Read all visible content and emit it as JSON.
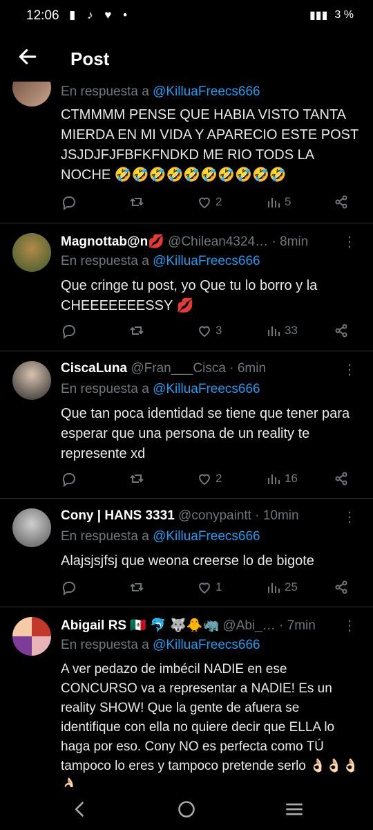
{
  "status": {
    "time": "12:06",
    "left_icons": "▮ ♪ ♥ •",
    "signal": "▮▮▮",
    "battery": "3 %"
  },
  "header": {
    "title": "Post"
  },
  "reply_prefix": "En respuesta a",
  "tweets": [
    {
      "name": "",
      "handle": "",
      "time": "",
      "reply_to": "@KilluaFreecs666",
      "body": "CTMMMM PENSE QUE HABIA VISTO TANTA MIERDA  EN MI VIDA Y APARECIO ESTE POST JSJDJFJFBFKFNDKD ME RIO TODS LA NOCHE 🤣🤣🤣🤣🤣🤣🤣🤣🤣🤣",
      "likes": "2",
      "views": "5"
    },
    {
      "name": "Magnottab@n💋",
      "handle": "@Chilean4324…",
      "time": "· 8min",
      "reply_to": "@KilluaFreecs666",
      "body": "Que cringe tu post, yo Que tu lo borro y la CHEEEEEEESSY 💋",
      "likes": "3",
      "views": "33"
    },
    {
      "name": "CiscaLuna",
      "handle": "@Fran___Cisca",
      "time": "· 6min",
      "reply_to": "@KilluaFreecs666",
      "body": "Que tan poca identidad se tiene que tener para esperar que una persona de un reality te represente xd",
      "likes": "2",
      "views": "16"
    },
    {
      "name": "Cony | HANS 3331",
      "handle": "@conypaintt",
      "time": "· 10min",
      "reply_to": "@KilluaFreecs666",
      "body": "Alajsjsjfsj que weona creerse lo de bigote",
      "likes": "1",
      "views": "25"
    },
    {
      "name": "Abigail RS 🇲🇽 🐬 🐺🐥🦏",
      "handle": "@Abi_…",
      "time": "· 7min",
      "reply_to": "@KilluaFreecs666",
      "body": "A ver pedazo de imbécil NADIE en ese CONCURSO va a representar a NADIE! Es un reality SHOW! Que la gente de afuera se identifique con ella no quiere decir que ELLA lo haga por eso. Cony NO es perfecta como TÚ tampoco lo eres y tampoco pretende serlo 👌🏻👌🏻👌🏻👌🏻",
      "likes": "",
      "views": ""
    }
  ],
  "colors": {
    "background": "#000000",
    "text": "#e7e9ea",
    "muted": "#71767b",
    "link": "#1d9bf0",
    "divider": "#2f3336"
  }
}
